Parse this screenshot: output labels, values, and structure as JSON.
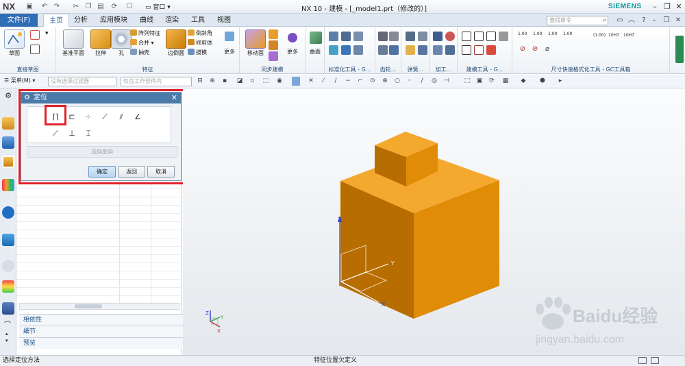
{
  "titlebar": {
    "logo": "NX",
    "window_menu": "窗口",
    "title": "NX 10 - 建模 - [_model1.prt（修改的）]",
    "brand": "SIEMENS"
  },
  "tabs": [
    {
      "label": "文件(F)"
    },
    {
      "label": "主页"
    },
    {
      "label": "分析"
    },
    {
      "label": "应用模块"
    },
    {
      "label": "曲线"
    },
    {
      "label": "渲染"
    },
    {
      "label": "工具"
    },
    {
      "label": "视图"
    }
  ],
  "search": {
    "placeholder": "查找命令"
  },
  "ribbon": {
    "sketch_label": "草图",
    "group_direct_sketch": "直接草图",
    "datum_plane": "基准平面",
    "extrude": "拉伸",
    "hole": "孔",
    "pattern_feature": "阵列特征",
    "unite": "合并",
    "shell": "抽壳",
    "edge_blend": "边倒圆",
    "chamfer": "倒斜角",
    "trim_body": "修剪体",
    "draft": "拔模",
    "more": "更多",
    "group_feature": "特征",
    "move_face": "移动面",
    "group_sync": "同步建模",
    "more2": "更多",
    "surface": "曲面",
    "group_standard": "标准化工具 - G...",
    "group_gear": "齿轮...",
    "group_spring": "弹簧...",
    "group_machining": "加工...",
    "group_modeling_tools": "建模工具 - G...",
    "group_dimension": "尺寸快速格式化工具 - GC工具箱",
    "dim_labels": [
      "1.00",
      "1.00",
      "1.00",
      "1.00",
      "(1.00)",
      "10H7",
      "10H7"
    ]
  },
  "filterbar": {
    "menu": "菜单(M)",
    "filter_placeholder": "没有选择过滤器",
    "scope_placeholder": "仅在工作部件内"
  },
  "dialog": {
    "title": "定位",
    "reverse_label": "法向反向",
    "ok": "确定",
    "back": "返回",
    "cancel": "取消"
  },
  "navpanel": {
    "sections": [
      "相依性",
      "细节",
      "预览"
    ]
  },
  "viewport": {
    "axis_x": "X",
    "axis_y": "Y",
    "axis_z": "Z",
    "triad_x": "X",
    "triad_y": "Y",
    "triad_z": "Z",
    "watermark_main": "Baidu经验",
    "watermark_sub": "jingyan.baidu.com"
  },
  "statusbar": {
    "left": "选择定位方法",
    "center": "特征位置欠定义"
  },
  "colors": {
    "accent": "#2f6db5",
    "cube_top": "#f4a82d",
    "cube_front": "#e08c06",
    "cube_side": "#b86d00",
    "highlight": "#e0202a"
  }
}
